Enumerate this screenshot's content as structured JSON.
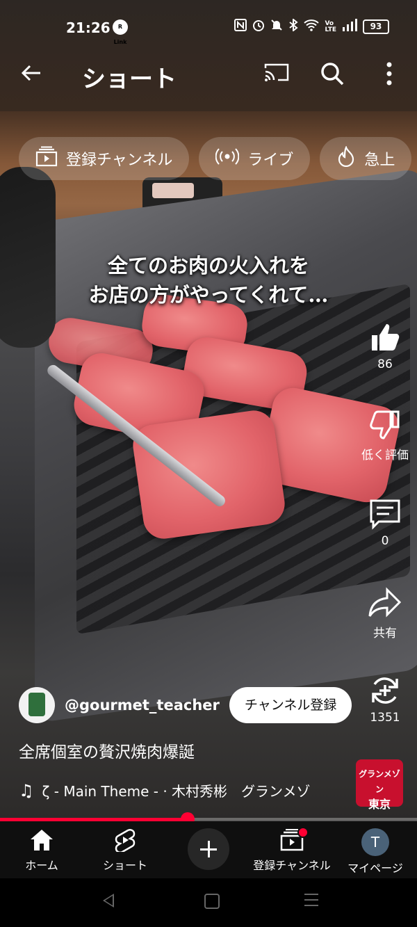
{
  "status_bar": {
    "time": "21:26",
    "rlink_badge": "R Link",
    "battery": "93",
    "icons": [
      "nfc-icon",
      "alarm-icon",
      "mute-icon",
      "bluetooth-icon",
      "wifi-icon",
      "volte-icon",
      "signal-icon",
      "battery-icon"
    ]
  },
  "top_bar": {
    "title": "ショート"
  },
  "chips": [
    {
      "label": "登録チャンネル",
      "icon": "subscriptions-icon"
    },
    {
      "label": "ライブ",
      "icon": "live-icon"
    },
    {
      "label": "急上",
      "icon": "trending-icon"
    }
  ],
  "video": {
    "caption_line1": "全てのお肉の火入れを",
    "caption_line2": "お店の方がやってくれて…"
  },
  "actions": {
    "like_count": "86",
    "dislike_label": "低く評価",
    "comment_count": "0",
    "share_label": "共有",
    "remix_count": "1351"
  },
  "channel": {
    "handle": "@gourmet_teacher",
    "subscribe_label": "チャンネル登録"
  },
  "description": "全席個室の贅沢焼肉爆誕",
  "music": {
    "text": "ζ - Main Theme - · 木村秀彬　グランメゾ"
  },
  "brand_logo": {
    "line1": "グランメゾン",
    "line2": "東京"
  },
  "progress": {
    "fraction": 0.45
  },
  "bottom_nav": {
    "home": "ホーム",
    "shorts": "ショート",
    "subscriptions": "登録チャンネル",
    "my_page": "マイページ",
    "avatar_initial": "T"
  },
  "colors": {
    "accent": "#ff0033",
    "nav_bg": "#0f0f0f"
  }
}
